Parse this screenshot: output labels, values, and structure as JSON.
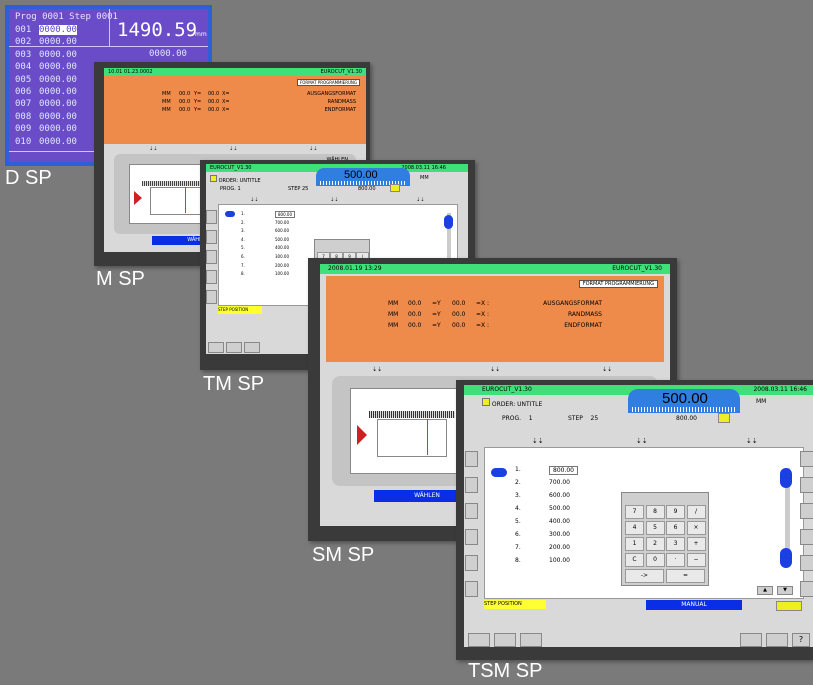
{
  "captions": {
    "dsp": "D SP",
    "msp": "M SP",
    "tmsp": "TM SP",
    "smsp": "SM SP",
    "tsmsp": "TSM SP"
  },
  "dsp": {
    "header": "Prog  0001 Step  0001",
    "big_value": "1490.59",
    "big_unit": "mm",
    "small_value": "0000.00",
    "rows": [
      {
        "num": "001",
        "val": "0000.00"
      },
      {
        "num": "002",
        "val": "0000.00"
      },
      {
        "num": "003",
        "val": "0000.00"
      },
      {
        "num": "004",
        "val": "0000.00"
      },
      {
        "num": "005",
        "val": "0000.00"
      },
      {
        "num": "006",
        "val": "0000.00"
      },
      {
        "num": "007",
        "val": "0000.00"
      },
      {
        "num": "008",
        "val": "0000.00"
      },
      {
        "num": "009",
        "val": "0000.00"
      },
      {
        "num": "010",
        "val": "0000.00"
      }
    ]
  },
  "msp": {
    "left_header": "10.01 01.23.0002",
    "right_header": "EUROCUT_V1.30",
    "format_label": "FORMAT PROGRAMMIERUNG",
    "rows": [
      {
        "label": "AUSGANGSFORMAT",
        "x": "X=",
        "y": "00.0",
        "xv": "Y=",
        "yv": "00.0",
        "unit": "MM"
      },
      {
        "label": "RANDMASS",
        "x": "X=",
        "y": "00.0",
        "xv": "Y=",
        "yv": "00.0",
        "unit": "MM"
      },
      {
        "label": "ENDFORMAT",
        "x": "X=",
        "y": "00.0",
        "xv": "Y=",
        "yv": "00.0",
        "unit": "MM"
      }
    ],
    "select_label": "WÄHLEN"
  },
  "tmsp": {
    "title": "EUROCUT_V1.30",
    "datetime": "2008.03.11 16:46",
    "order": "ORDER: UNTITLE",
    "prog_label": "PROG.",
    "prog": "1",
    "step_label": "STEP",
    "step": "25",
    "big_value": "500.00",
    "unit": "MM",
    "pos": "800.00",
    "list": [
      {
        "n": "1.",
        "v": "800.00"
      },
      {
        "n": "2.",
        "v": "700.00"
      },
      {
        "n": "3.",
        "v": "600.00"
      },
      {
        "n": "4.",
        "v": "500.00"
      },
      {
        "n": "5.",
        "v": "400.00"
      },
      {
        "n": "6.",
        "v": "300.00"
      },
      {
        "n": "7.",
        "v": "200.00"
      },
      {
        "n": "8.",
        "v": "100.00"
      }
    ],
    "step_position": "STEP POSITION",
    "keys_visible": [
      "7",
      "8",
      "9",
      "/"
    ]
  },
  "smsp": {
    "left_header": "2008.01.19 13:29",
    "right_header": "EUROCUT_V1.30",
    "format_label": "FORMAT PROGRAMMIERUNG",
    "rows": [
      {
        "label": "AUSGANGSFORMAT",
        "unit": "MM",
        "xv": "00.0",
        "ye": "=Y",
        "yv": "00.0",
        "xe": "=X :"
      },
      {
        "label": "RANDMASS",
        "unit": "MM",
        "xv": "00.0",
        "ye": "=Y",
        "yv": "00.0",
        "xe": "=X :"
      },
      {
        "label": "ENDFORMAT",
        "unit": "MM",
        "xv": "00.0",
        "ye": "=Y",
        "yv": "00.0",
        "xe": "=X :"
      }
    ],
    "select_label": "WÄHLEN"
  },
  "tsmsp": {
    "title": "EUROCUT_V1.30",
    "datetime": "2008.03.11 16:46",
    "order": "ORDER: UNTITLE",
    "prog_label": "PROG.",
    "prog": "1",
    "step_label": "STEP",
    "step": "25",
    "big_value": "500.00",
    "unit": "MM",
    "pos": "800.00",
    "list": [
      {
        "n": "1.",
        "v": "800.00"
      },
      {
        "n": "2.",
        "v": "700.00"
      },
      {
        "n": "3.",
        "v": "600.00"
      },
      {
        "n": "4.",
        "v": "500.00"
      },
      {
        "n": "5.",
        "v": "400.00"
      },
      {
        "n": "6.",
        "v": "300.00"
      },
      {
        "n": "7.",
        "v": "200.00"
      },
      {
        "n": "8.",
        "v": "100.00"
      }
    ],
    "keys": [
      "7",
      "8",
      "9",
      "/",
      "4",
      "5",
      "6",
      "×",
      "1",
      "2",
      "3",
      "+",
      "C",
      "0",
      "·",
      "−",
      "->",
      "="
    ],
    "step_position": "STEP POSITION",
    "mode": "MANUAL"
  }
}
